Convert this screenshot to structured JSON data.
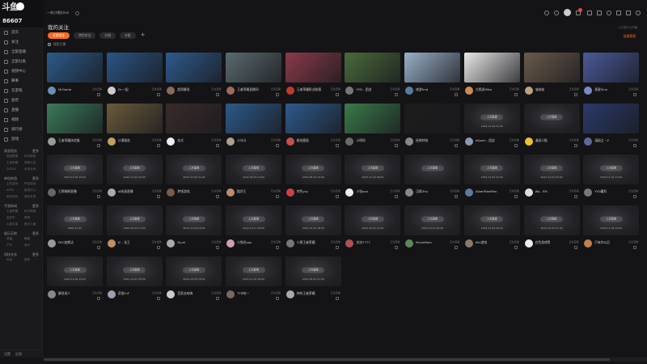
{
  "brand": {
    "logo_text": "斗鱼",
    "number": "86607"
  },
  "window": {
    "tab_title": "一刻小镜队live",
    "titlebar_badge": "99"
  },
  "sidebar": {
    "items": [
      {
        "label": "首页",
        "icon": "home-icon"
      },
      {
        "label": "关注",
        "icon": "heart-icon"
      },
      {
        "label": "全部直播",
        "icon": "grid-icon"
      },
      {
        "label": "全部分类",
        "icon": "category-icon"
      },
      {
        "label": "视频中心",
        "icon": "video-icon"
      },
      {
        "label": "赛事",
        "icon": "trophy-icon"
      },
      {
        "label": "云游戏",
        "icon": "cloud-icon"
      },
      {
        "label": "鱼吧",
        "icon": "fish-icon"
      },
      {
        "label": "直播",
        "icon": "live-icon"
      },
      {
        "label": "视频",
        "icon": "film-icon"
      },
      {
        "label": "排行榜",
        "icon": "rank-icon"
      },
      {
        "label": "游戏",
        "icon": "gamepad-icon"
      }
    ],
    "sections": [
      {
        "title": "网游竞技",
        "more": "更多",
        "subs": [
          "英雄联盟",
          "和平精英",
          "王者荣耀",
          "穿越火线",
          "DOTA2",
          "永劫无间"
        ]
      },
      {
        "title": "单机热游",
        "more": "更多",
        "subs": [
          "主机游戏",
          "怀旧游戏",
          "APEX",
          "新游中心",
          "单机游戏",
          "我的世界"
        ]
      },
      {
        "title": "手游休闲",
        "more": "更多",
        "subs": [
          "王者荣耀",
          "和平精英",
          "金铲铲",
          "原神",
          "火影忍者",
          "第五人格"
        ]
      },
      {
        "title": "娱乐天地",
        "more": "更多",
        "subs": [
          "颜值",
          "舞蹈",
          "户外",
          "音乐"
        ]
      },
      {
        "title": "科技文化",
        "more": "更多",
        "subs": [
          "科技",
          "数码"
        ]
      }
    ],
    "footer": {
      "settings": "设置",
      "feedback": "反馈"
    }
  },
  "main": {
    "title": "我的关注",
    "hint": "上方显示已开播",
    "tabs": [
      {
        "label": "全部关注"
      },
      {
        "label": "特别关注"
      },
      {
        "label": "分组"
      },
      {
        "label": "分组"
      }
    ],
    "batch_label": "批量管理",
    "search_placeholder": "搜索主播"
  },
  "offline_label": "上次直播",
  "cards": [
    {
      "name": "MrGamb",
      "status": "正在直播",
      "live": true,
      "thumb": "#2c5a8a",
      "avatar": "#6a8fb0"
    },
    {
      "name": "Dr.一起",
      "status": "正在直播",
      "live": true,
      "thumb": "#2a5585",
      "avatar": "#ccc"
    },
    {
      "name": "超哥解说",
      "status": "正在直播",
      "live": true,
      "thumb": "#2e5a8c",
      "avatar": "#8a6a5a"
    },
    {
      "name": "王者荣耀直播间",
      "status": "正在直播",
      "live": true,
      "thumb": "#5a6a70",
      "avatar": "#a06a5a"
    },
    {
      "name": "王者荣耀职业联赛",
      "status": "正在直播",
      "live": true,
      "thumb": "#8a3a4a",
      "avatar": "#c0392b"
    },
    {
      "name": "YYD - 团战",
      "status": "正在直播",
      "live": true,
      "thumb": "#4a6a3a",
      "avatar": "#777"
    },
    {
      "name": "旅游frnd",
      "status": "正在直播",
      "live": true,
      "thumb": "#9ab0c8",
      "avatar": "#5a7aa0"
    },
    {
      "name": "大胖虎Mika",
      "status": "正在直播",
      "live": true,
      "thumb": "#e8e8e8",
      "avatar": "#d08a50"
    },
    {
      "name": "喵喵喵",
      "status": "正在直播",
      "live": true,
      "thumb": "#6a5a4a",
      "avatar": "#bfa080"
    },
    {
      "name": "星星Sina",
      "status": "正在直播",
      "live": true,
      "thumb": "#4a5a9a",
      "avatar": "#7a8ac0"
    },
    {
      "name": "王者荣耀体验服",
      "status": "正在直播",
      "live": true,
      "thumb": "#3a7a5a",
      "avatar": "#999"
    },
    {
      "name": "沙漠骆驼",
      "status": "正在直播",
      "live": true,
      "thumb": "#6a5a3a",
      "avatar": "#c4a060"
    },
    {
      "name": "花式",
      "status": "正在直播",
      "live": true,
      "thumb": "#3a2a2a",
      "avatar": "#eee"
    },
    {
      "name": "小乌马",
      "status": "正在直播",
      "live": true,
      "thumb": "#2c5a8a",
      "avatar": "#b0a090"
    },
    {
      "name": "解说鹿晗",
      "status": "正在直播",
      "live": true,
      "thumb": "#2e5a8c",
      "avatar": "#c05050"
    },
    {
      "name": "小明同",
      "status": "正在直播",
      "live": true,
      "thumb": "#3a7a4a",
      "avatar": "#6a6a6a"
    },
    {
      "name": "经典特效",
      "status": "正在直播",
      "live": true,
      "thumb": "#1c1c1c",
      "avatar": "#888"
    },
    {
      "name": "eSport - 团战",
      "status": "正在直播",
      "live": false,
      "time": "2022-11-04 21:00",
      "avatar": "#8a9ab0"
    },
    {
      "name": "漫画小猫",
      "status": "正在直播",
      "live": false,
      "time": "",
      "avatar": "#f0c030"
    },
    {
      "name": "漫画艾・Z",
      "status": "正在直播",
      "live": true,
      "thumb": "#2a3a6a",
      "avatar": "#5a6a9a"
    },
    {
      "name": "王牌刷刷直播",
      "status": "正在直播",
      "live": false,
      "time": "2022-11-04 14:00",
      "avatar": "#666"
    },
    {
      "name": "AI绘画直播",
      "status": "正在直播",
      "live": false,
      "time": "2022-11-03 20:00",
      "avatar": "#aaa"
    },
    {
      "name": "梦境游戏",
      "status": "正在直播",
      "live": false,
      "time": "2022-11-04 21:00",
      "avatar": "#7a5a4a"
    },
    {
      "name": "酷伊王",
      "status": "正在直播",
      "live": false,
      "time": "2022-09-25 14:00",
      "avatar": "#c08a6a"
    },
    {
      "name": "特色ysy",
      "status": "正在直播",
      "live": false,
      "time": "2022-08-14 19:00",
      "avatar": "#d04040"
    },
    {
      "name": "小张ooo",
      "status": "正在直播",
      "live": false,
      "time": "2022-11-04 08:00",
      "avatar": "#eee"
    },
    {
      "name": "汉斯Zhu",
      "status": "正在直播",
      "live": false,
      "time": "",
      "avatar": "#888"
    },
    {
      "name": "AlbertRadMan",
      "status": "正在直播",
      "live": false,
      "time": "2022-11-03 21:00",
      "avatar": "#5a7aa0"
    },
    {
      "name": "Wo - RH",
      "status": "正在直播",
      "live": false,
      "time": "2022-11-03 20:00",
      "avatar": "#ddd"
    },
    {
      "name": "YYD赢利",
      "status": "正在直播",
      "live": false,
      "time": "2022-11-01 17:00",
      "avatar": "#777"
    },
    {
      "name": "PAO加斯达",
      "status": "正在直播",
      "live": false,
      "time": "2022-11-02",
      "avatar": "#999"
    },
    {
      "name": "JC - 金王",
      "status": "正在直播",
      "live": false,
      "time": "2022-09-24 13:00",
      "avatar": "#c09060"
    },
    {
      "name": "Dyuli",
      "status": "正在直播",
      "live": false,
      "time": "2022-11-04 18:00",
      "avatar": "#aaa"
    },
    {
      "name": "小兔优ooo",
      "status": "正在直播",
      "live": false,
      "time": "2022-10-17 18:00",
      "avatar": "#d0a0b0"
    },
    {
      "name": "小黑王者荣耀",
      "status": "正在直播",
      "live": false,
      "time": "2022-10-24 18:00",
      "avatar": "#777"
    },
    {
      "name": "凉凉7777",
      "status": "正在直播",
      "live": false,
      "time": "2022-10-07 22:00",
      "avatar": "#b05050"
    },
    {
      "name": "MovieRom",
      "status": "正在直播",
      "live": false,
      "time": "2022-10-10 20:00",
      "avatar": "#5a8a5a"
    },
    {
      "name": "Kiki游戏",
      "status": "正在直播",
      "live": false,
      "time": "2022-11-03 20:00",
      "avatar": "#8a7a6a"
    },
    {
      "name": "白色游戏等",
      "status": "正在直播",
      "live": false,
      "time": "2022-10-07 11:00",
      "avatar": "#eee"
    },
    {
      "name": "只有你以后",
      "status": "正在直播",
      "live": false,
      "time": "2022-11-04 16:00",
      "avatar": "#c08050"
    },
    {
      "name": "解说说人",
      "status": "正在直播",
      "live": false,
      "time": "2022-11-04 13:00",
      "avatar": "#888"
    },
    {
      "name": "奇怪FuF",
      "status": "正在直播",
      "live": false,
      "time": "2021-12-01 18:00",
      "avatar": "#9aa0b0"
    },
    {
      "name": "百家去哈嗨",
      "status": "正在直播",
      "live": false,
      "time": "2022-10-05 18:00",
      "avatar": "#ccc"
    },
    {
      "name": "TTD哈一",
      "status": "正在直播",
      "live": false,
      "time": "2022-11-01 18:00",
      "avatar": "#7a6a5a"
    },
    {
      "name": "帅的王者荣耀",
      "status": "正在直播",
      "live": false,
      "time": "2022-09-25 21:00",
      "avatar": "#aaa"
    }
  ]
}
